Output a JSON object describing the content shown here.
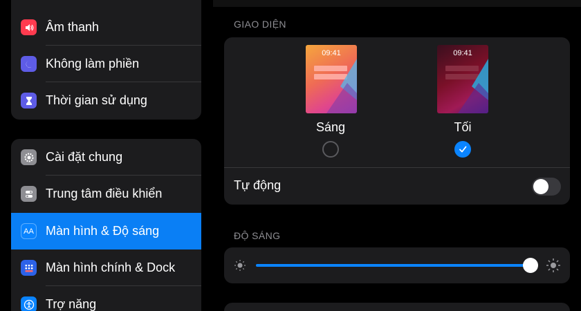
{
  "sidebar": {
    "group1": [
      {
        "label": "Âm thanh",
        "icon": "speaker-icon",
        "color": "#ff3b4f"
      },
      {
        "label": "Không làm phiền",
        "icon": "moon-icon",
        "color": "#5e5ce6"
      },
      {
        "label": "Thời gian sử dụng",
        "icon": "hourglass-icon",
        "color": "#5e5ce6"
      }
    ],
    "group2": [
      {
        "label": "Cài đặt chung",
        "icon": "gear-icon",
        "color": "#8e8e93"
      },
      {
        "label": "Trung tâm điều khiển",
        "icon": "toggles-icon",
        "color": "#8e8e93"
      },
      {
        "label": "Màn hình & Độ sáng",
        "icon": "text-size-icon",
        "color": "#0a84ff",
        "selected": true
      },
      {
        "label": "Màn hình chính & Dock",
        "icon": "app-grid-icon",
        "color": "#2c62e8"
      },
      {
        "label": "Trợ năng",
        "icon": "accessibility-icon",
        "color": "#0a84ff"
      }
    ]
  },
  "appearance": {
    "section_title": "GIAO DIỆN",
    "light": {
      "label": "Sáng",
      "time": "09:41",
      "selected": false
    },
    "dark": {
      "label": "Tối",
      "time": "09:41",
      "selected": true
    },
    "auto_label": "Tự động",
    "auto_enabled": false
  },
  "brightness": {
    "section_title": "ĐỘ SÁNG",
    "level": 1.0
  },
  "colors": {
    "accent": "#0a84ff",
    "card": "#1c1c1e",
    "selected_row": "#0a7ff5"
  }
}
